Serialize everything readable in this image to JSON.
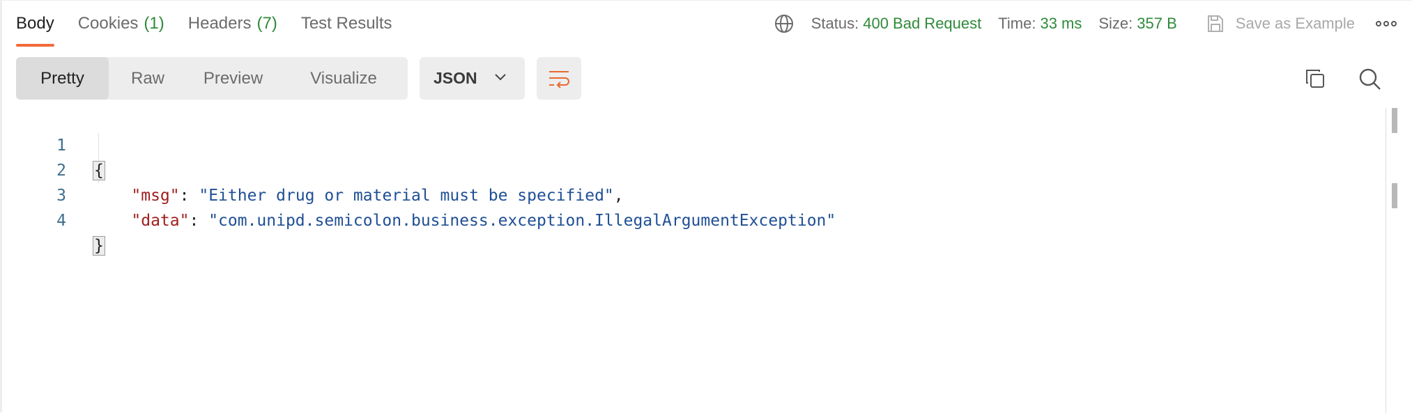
{
  "tabs": [
    {
      "label": "Body",
      "count": ""
    },
    {
      "label": "Cookies",
      "count": "(1)"
    },
    {
      "label": "Headers",
      "count": "(7)"
    },
    {
      "label": "Test Results",
      "count": ""
    }
  ],
  "status": {
    "status_label": "Status:",
    "status_value": "400 Bad Request",
    "time_label": "Time:",
    "time_value": "33 ms",
    "size_label": "Size:",
    "size_value": "357 B",
    "save_label": "Save as Example"
  },
  "view_modes": [
    "Pretty",
    "Raw",
    "Preview",
    "Visualize"
  ],
  "active_view": "Pretty",
  "format_select": "JSON",
  "code": {
    "line_numbers": [
      "1",
      "2",
      "3",
      "4"
    ],
    "open_brace": "{",
    "close_brace": "}",
    "k1": "\"msg\"",
    "v1": "\"Either drug or material must be specified\"",
    "k2": "\"data\"",
    "v2": "\"com.unipd.semicolon.business.exception.IllegalArgumentException\""
  },
  "colors": {
    "accent": "#f26b3a",
    "status_ok": "#2f8a3a",
    "json_key": "#a11d1d",
    "json_string": "#1f4f95"
  }
}
